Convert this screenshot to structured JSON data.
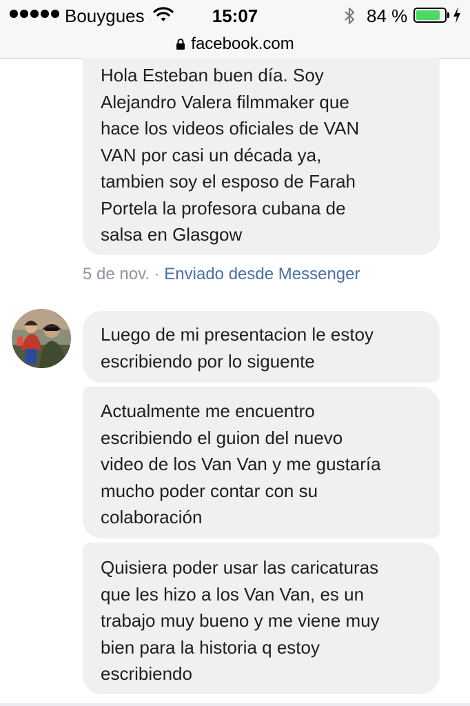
{
  "status_bar": {
    "carrier": "Bouygues",
    "time": "15:07",
    "battery_percent": "84 %",
    "battery_level": 0.84,
    "battery_color": "#4cd964"
  },
  "browser": {
    "url": "facebook.com",
    "lock_icon": "lock-icon"
  },
  "conversation": {
    "messages": [
      {
        "text": "Hola Esteban buen día. Soy\nAlejandro Valera filmmaker que\nhace los videos oficiales  de VAN\nVAN por casi un década ya,\ntambien  soy el esposo de Farah\nPortela la profesora cubana de\nsalsa en Glasgow"
      },
      {
        "text": "Luego de mi presentacion le estoy\nescribiendo por lo siguente"
      },
      {
        "text": "Actualmente me encuentro\nescribiendo el guion del nuevo\nvideo de los Van Van y me gustaría\nmucho poder contar con su\ncolaboración"
      },
      {
        "text": "Quisiera poder usar las caricaturas\nque les  hizo a los Van Van, es un\ntrabajo muy bueno y me viene muy\nbien para la historia q estoy\nescribiendo"
      }
    ],
    "timestamp": "5 de nov.",
    "separator": " · ",
    "sent_via": "Enviado desde Messenger"
  },
  "colors": {
    "bubble_bg": "#f1f0f0",
    "meta_text": "#8d949e",
    "link": "#4b6fa8"
  }
}
